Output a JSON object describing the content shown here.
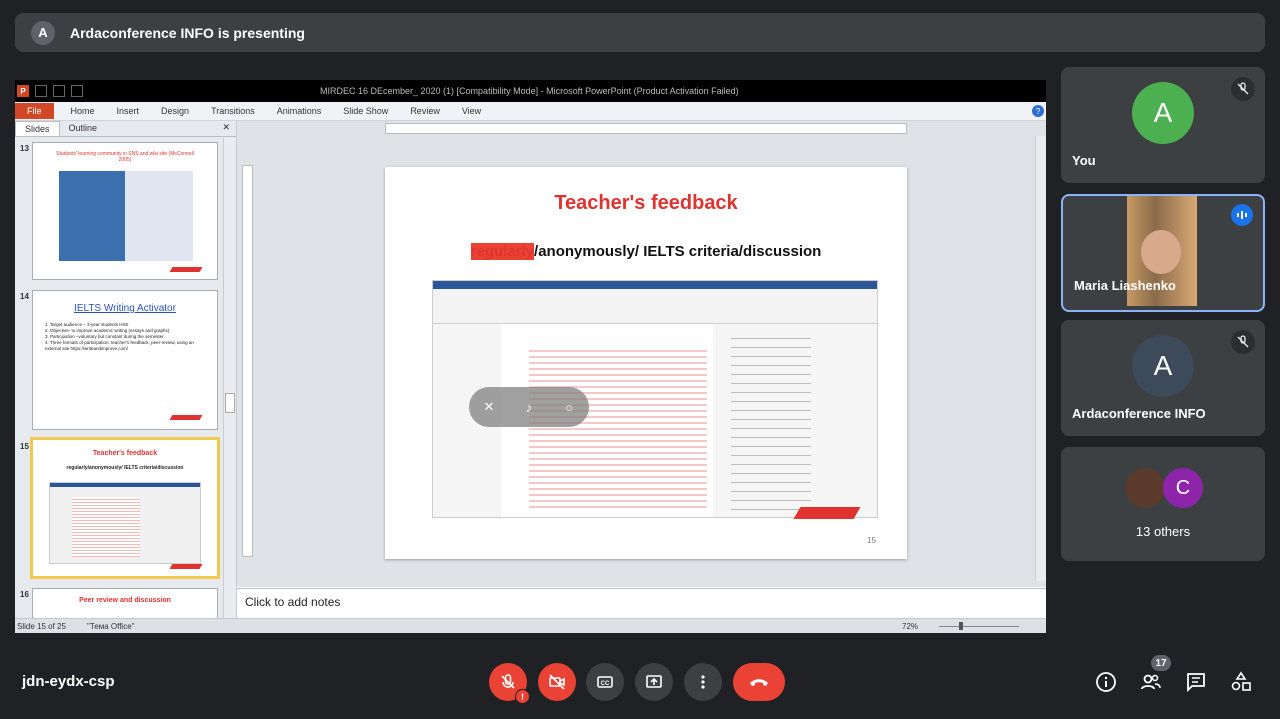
{
  "banner": {
    "avatar_letter": "A",
    "text": "Ardaconference INFO is presenting"
  },
  "ppt": {
    "title": "MIRDEC 16 DEcember_ 2020 (1) [Compatibility Mode] - Microsoft PowerPoint (Product Activation Failed)",
    "menu": [
      "File",
      "Home",
      "Insert",
      "Design",
      "Transitions",
      "Animations",
      "Slide Show",
      "Review",
      "View"
    ],
    "panel_tabs": [
      "Slides",
      "Outline"
    ],
    "thumbs": [
      {
        "num": "13",
        "title": "Students' learning community in SNS and wiki site (McConnell 2005)"
      },
      {
        "num": "14",
        "title": "IELTS Writing Activator",
        "bullets": [
          "1. Target audience – 3-year students HSE",
          "2. Objective- to improve academic writing (essays and graphs)",
          "3. Participation –voluntary but constant during the semester",
          "4. Three formats of participation: teacher's feedback, peer-review, using an external site https://writeandimprove.com/"
        ]
      },
      {
        "num": "15",
        "title": "Teacher's feedback",
        "subtitle": "regularly/anonymously/ IELTS criteria/discussion"
      },
      {
        "num": "16",
        "title": "Peer review and discussion"
      }
    ],
    "slide": {
      "title": "Teacher's feedback",
      "sub_red": "regularly",
      "sub_rest": "/anonymously/ IELTS criteria/discussion",
      "number": "15"
    },
    "notes_placeholder": "Click to add notes",
    "status": {
      "slide_pos": "Slide 15 of 25",
      "theme": "\"Тема Office\"",
      "zoom": "72%"
    }
  },
  "participants": [
    {
      "name": "You",
      "avatar_letter": "A",
      "avatar_color": "#4caf50",
      "muted": true
    },
    {
      "name": "Maria Liashenko",
      "speaking": true
    },
    {
      "name": "Ardaconference INFO",
      "avatar_letter": "A",
      "avatar_color": "#3c4a5a",
      "muted": true
    },
    {
      "name": "13 others",
      "avatar_letter": "C",
      "avatar_color": "#8e24aa"
    }
  ],
  "meeting": {
    "code": "jdn-eydx-csp",
    "participant_count": "17"
  },
  "colors": {
    "accent_red": "#ea4335",
    "speaking_blue": "#1a73e8",
    "ppt_red": "#e0332f"
  }
}
